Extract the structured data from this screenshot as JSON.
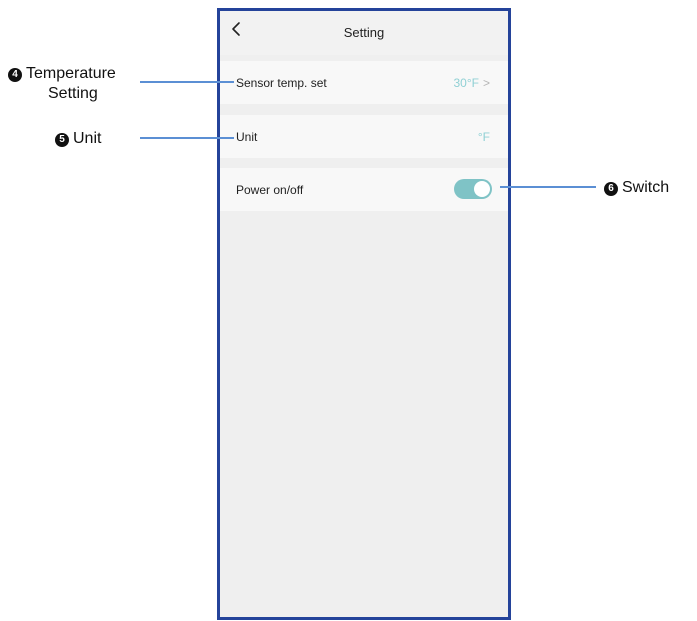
{
  "header": {
    "title": "Setting"
  },
  "rows": [
    {
      "label": "Sensor temp. set",
      "value": "30°F",
      "chevron": ">"
    },
    {
      "label": "Unit",
      "value": "°F"
    },
    {
      "label": "Power on/off",
      "toggle_state": "on"
    }
  ],
  "callouts": {
    "temperature": {
      "number": "4",
      "line1": "Temperature",
      "line2": "Setting"
    },
    "unit": {
      "number": "5",
      "text": "Unit"
    },
    "switch": {
      "number": "6",
      "text": "Switch"
    }
  },
  "colors": {
    "frame_border": "#24439a",
    "accent_value": "#8fd0d4",
    "toggle_on": "#7fc3c6",
    "callout_line": "#5b8fd4"
  }
}
